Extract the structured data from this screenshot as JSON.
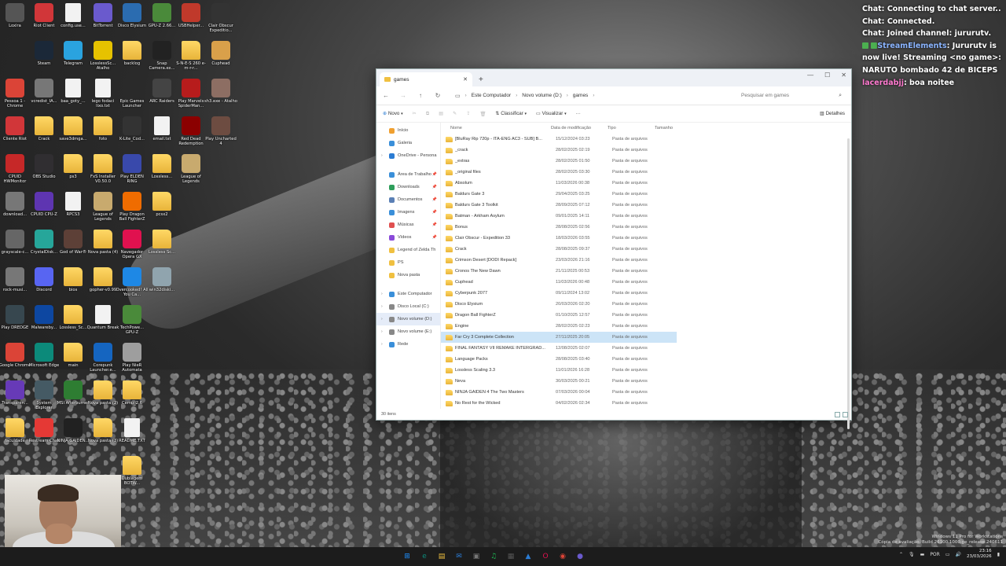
{
  "desktop_icons": [
    {
      "label": "Loxira",
      "kind": "app",
      "color": "#555555"
    },
    {
      "label": "Riot Client",
      "kind": "app",
      "color": "#d13639"
    },
    {
      "label": "config.use...",
      "kind": "file",
      "color": "#f2f2f2"
    },
    {
      "label": "BitTorrent",
      "kind": "app",
      "color": "#6a5acd"
    },
    {
      "label": "Disco Elysium",
      "kind": "app",
      "color": "#2b6cb0"
    },
    {
      "label": "GPU-Z 2.66...",
      "kind": "app",
      "color": "#4a8a3a"
    },
    {
      "label": "USBHelper...",
      "kind": "app",
      "color": "#c0392b"
    },
    {
      "label": "Clair Obscur Expeditio...",
      "kind": "app",
      "color": "#333333"
    },
    {
      "label": "Steam",
      "kind": "app",
      "color": "#1b2838"
    },
    {
      "label": "Telegram",
      "kind": "app",
      "color": "#2aa3df"
    },
    {
      "label": "LosslessSc... Atalho",
      "kind": "app",
      "color": "#e6c200"
    },
    {
      "label": "backlog",
      "kind": "folder",
      "color": "#f0c040"
    },
    {
      "label": "Snap Camera.ex...",
      "kind": "app",
      "color": "#222222"
    },
    {
      "label": "S-N-E-S 260 e-m-r-r...",
      "kind": "folder",
      "color": "#f0c040"
    },
    {
      "label": "Cuphead",
      "kind": "app",
      "color": "#d9a04a"
    },
    {
      "label": "Pessoa 1 - Chrome",
      "kind": "app",
      "color": "#db4437"
    },
    {
      "label": "vcredist_IA...",
      "kind": "app",
      "color": "#777777"
    },
    {
      "label": "baa_goty_...",
      "kind": "file",
      "color": "#f2f2f2"
    },
    {
      "label": "lego fodaci lixo.txt",
      "kind": "file",
      "color": "#f2f2f2"
    },
    {
      "label": "Epic Games Launcher",
      "kind": "app",
      "color": "#2a2a2a"
    },
    {
      "label": "ARC Raiders",
      "kind": "app",
      "color": "#444444"
    },
    {
      "label": "Play Marvels SpiderMan...",
      "kind": "app",
      "color": "#b71c1c"
    },
    {
      "label": "sh3.exe - Atalho",
      "kind": "app",
      "color": "#8d6e63"
    },
    {
      "label": "Cliente Riot",
      "kind": "app",
      "color": "#d13639"
    },
    {
      "label": "Crack",
      "kind": "folder",
      "color": "#f0c040"
    },
    {
      "label": "save3dmga...",
      "kind": "folder",
      "color": "#f0c040"
    },
    {
      "label": "foto",
      "kind": "folder",
      "color": "#f0c040"
    },
    {
      "label": "K-Lite_Cod...",
      "kind": "app",
      "color": "#333333"
    },
    {
      "label": "email.txt",
      "kind": "file",
      "color": "#f2f2f2"
    },
    {
      "label": "Red Dead Redemption",
      "kind": "app",
      "color": "#8b0000"
    },
    {
      "label": "Play Uncharted 4",
      "kind": "app",
      "color": "#6d4c41"
    },
    {
      "label": "CPUID HWMonitor",
      "kind": "app",
      "color": "#c62828"
    },
    {
      "label": "OBS Studio",
      "kind": "app",
      "color": "#302e31"
    },
    {
      "label": "ps3",
      "kind": "folder",
      "color": "#f0c040"
    },
    {
      "label": "FxS Installer V0.50.0",
      "kind": "folder",
      "color": "#f0c040"
    },
    {
      "label": "Play ELDEN RING",
      "kind": "app",
      "color": "#3949ab"
    },
    {
      "label": "Lossless...",
      "kind": "folder",
      "color": "#f0c040"
    },
    {
      "label": "League of Legends",
      "kind": "app",
      "color": "#c8aa6e"
    },
    {
      "label": "download...",
      "kind": "app",
      "color": "#777777"
    },
    {
      "label": "CPUID CPU-Z",
      "kind": "app",
      "color": "#5e35b1"
    },
    {
      "label": "RPCS3",
      "kind": "file",
      "color": "#f2f2f2"
    },
    {
      "label": "League of Legends",
      "kind": "app",
      "color": "#c8aa6e"
    },
    {
      "label": "Play Dragon Ball FighterZ",
      "kind": "app",
      "color": "#ef6c00"
    },
    {
      "label": "pcsx2",
      "kind": "folder",
      "color": "#f0c040"
    },
    {
      "label": "grayscale-c...",
      "kind": "app",
      "color": "#666666"
    },
    {
      "label": "CrystalDisk...",
      "kind": "app",
      "color": "#26a69a"
    },
    {
      "label": "God of War®",
      "kind": "app",
      "color": "#5d4037"
    },
    {
      "label": "Nova pasta (4)",
      "kind": "folder",
      "color": "#f0c040"
    },
    {
      "label": "Navegador Opera GX",
      "kind": "app",
      "color": "#e0114f"
    },
    {
      "label": "Lossless Sc...",
      "kind": "folder",
      "color": "#f0c040"
    },
    {
      "label": "rock-musi...",
      "kind": "app",
      "color": "#777777"
    },
    {
      "label": "Discord",
      "kind": "app",
      "color": "#5865f2"
    },
    {
      "label": "bios",
      "kind": "folder",
      "color": "#f0c040"
    },
    {
      "label": "gopher-v0.99",
      "kind": "folder",
      "color": "#f0c040"
    },
    {
      "label": "Overcooked! All You Ca...",
      "kind": "app",
      "color": "#1e88e5"
    },
    {
      "label": "win32diski...",
      "kind": "app",
      "color": "#90a4ae"
    },
    {
      "label": "Play DREDGE",
      "kind": "app",
      "color": "#37474f"
    },
    {
      "label": "Malwareby...",
      "kind": "app",
      "color": "#0d47a1"
    },
    {
      "label": "Lossless_Sc...",
      "kind": "folder",
      "color": "#f0c040"
    },
    {
      "label": "Quantum Break",
      "kind": "file",
      "color": "#f2f2f2"
    },
    {
      "label": "TechPowe... GPU-Z",
      "kind": "app",
      "color": "#4a8a3a"
    },
    {
      "label": "Google Chrome",
      "kind": "app",
      "color": "#db4437"
    },
    {
      "label": "Microsoft Edge",
      "kind": "app",
      "color": "#0c8a7a"
    },
    {
      "label": "main",
      "kind": "folder",
      "color": "#f0c040"
    },
    {
      "label": "Corepunk Launcher.e...",
      "kind": "app",
      "color": "#1565c0"
    },
    {
      "label": "Play NieR Automata",
      "kind": "app",
      "color": "#9e9e9e"
    },
    {
      "label": "Transparen...",
      "kind": "app",
      "color": "#673ab7"
    },
    {
      "label": "System Explorer",
      "kind": "app",
      "color": "#455a64"
    },
    {
      "label": "MSI Afterburner",
      "kind": "app",
      "color": "#2e7d32"
    },
    {
      "label": "Nova pasta (2)",
      "kind": "folder",
      "color": "#f0c040"
    },
    {
      "label": "Cemu_2.6",
      "kind": "folder",
      "color": "#f0c040"
    },
    {
      "label": "faculdade",
      "kind": "folder",
      "color": "#f0c040"
    },
    {
      "label": "Restream Chat",
      "kind": "app",
      "color": "#e53935"
    },
    {
      "label": "NINJA GAIDEN...",
      "kind": "app",
      "color": "#212121"
    },
    {
      "label": "Nova pasta (3)",
      "kind": "folder",
      "color": "#f0c040"
    },
    {
      "label": "README.TXT",
      "kind": "file",
      "color": "#f2f2f2"
    },
    {
      "label": "Dublagem BOTW...",
      "kind": "folder",
      "color": "#f0c040"
    }
  ],
  "chat": {
    "line1_name": "Chat:",
    "line1_text": "Connecting to chat server..",
    "line2_name": "Chat:",
    "line2_text": "Connected.",
    "line3_name": "Chat:",
    "line3_text": "Joined channel: jururutv.",
    "line4_name": "StreamElements",
    "line4_text": ": Jururutv is now live! Streaming <no game>: NARUTO bombado 42 de BICEPS",
    "line5_name": "lacerdabjj",
    "line5_text": ": boa noitee"
  },
  "explorer": {
    "tab_title": "games",
    "new_tab": "+",
    "address": {
      "root": "Este Computador",
      "drive": "Novo volume (D:)",
      "folder": "games"
    },
    "search_placeholder": "Pesquisar em games",
    "cmd": {
      "new": "Novo",
      "sort": "Classificar",
      "view": "Visualizar",
      "more": "···",
      "details": "Detalhes"
    },
    "nav": [
      {
        "label": "Início",
        "color": "#f0a030"
      },
      {
        "label": "Galeria",
        "color": "#3a8fd9"
      },
      {
        "label": "OneDrive - Persona",
        "color": "#2b7cd3",
        "chev": true
      },
      {
        "label": "Área de Trabalho",
        "color": "#3a8fd9",
        "pin": true
      },
      {
        "label": "Downloads",
        "color": "#2e9e5b",
        "pin": true
      },
      {
        "label": "Documentos",
        "color": "#5a7fb5",
        "pin": true
      },
      {
        "label": "Imagens",
        "color": "#3a8fd9",
        "pin": true
      },
      {
        "label": "Músicas",
        "color": "#e05050",
        "pin": true
      },
      {
        "label": "Vídeos",
        "color": "#8a4ad9",
        "pin": true
      },
      {
        "label": "Legend of Zelda Th",
        "color": "#f0c040"
      },
      {
        "label": "PS",
        "color": "#f0c040"
      },
      {
        "label": "Nova pasta",
        "color": "#f0c040"
      },
      {
        "label": "Este Computador",
        "color": "#3a8fd9",
        "chev": true
      },
      {
        "label": "Disco Local (C:)",
        "color": "#888888",
        "chev": true
      },
      {
        "label": "Novo volume (D:)",
        "color": "#888888",
        "chev": true,
        "selected": true
      },
      {
        "label": "Novo volume (E:)",
        "color": "#888888",
        "chev": true
      },
      {
        "label": "Rede",
        "color": "#3a8fd9",
        "chev": true
      }
    ],
    "columns": {
      "name": "Nome",
      "date": "Data de modificação",
      "type": "Tipo",
      "size": "Tamanho"
    },
    "files": [
      {
        "name": "[BluRay Rip 720p - ITA-ENG AC3 - SUB] B...",
        "date": "15/12/2024 03:23",
        "type": "Pasta de arquivos"
      },
      {
        "name": "_crack",
        "date": "28/02/2025 02:19",
        "type": "Pasta de arquivos"
      },
      {
        "name": "_extras",
        "date": "28/02/2025 01:50",
        "type": "Pasta de arquivos"
      },
      {
        "name": "_original files",
        "date": "28/02/2025 03:30",
        "type": "Pasta de arquivos"
      },
      {
        "name": "Absolum",
        "date": "11/03/2026 00:38",
        "type": "Pasta de arquivos"
      },
      {
        "name": "Baldurs Gate 3",
        "date": "29/04/2025 03:25",
        "type": "Pasta de arquivos"
      },
      {
        "name": "Baldurs Gate 3 Toolkit",
        "date": "28/09/2025 07:12",
        "type": "Pasta de arquivos"
      },
      {
        "name": "Batman - Arkham Asylum",
        "date": "09/01/2025 14:11",
        "type": "Pasta de arquivos"
      },
      {
        "name": "Bonus",
        "date": "28/08/2025 02:56",
        "type": "Pasta de arquivos"
      },
      {
        "name": "Clair Obscur - Expedition 33",
        "date": "18/03/2026 03:55",
        "type": "Pasta de arquivos"
      },
      {
        "name": "Crack",
        "date": "28/08/2025 09:37",
        "type": "Pasta de arquivos"
      },
      {
        "name": "Crimson Desert [DODI Repack]",
        "date": "23/03/2026 21:16",
        "type": "Pasta de arquivos"
      },
      {
        "name": "Cronos The New Dawn",
        "date": "21/11/2025 00:53",
        "type": "Pasta de arquivos"
      },
      {
        "name": "Cuphead",
        "date": "11/03/2026 00:48",
        "type": "Pasta de arquivos"
      },
      {
        "name": "Cyberpunk 2077",
        "date": "09/11/2024 13:02",
        "type": "Pasta de arquivos"
      },
      {
        "name": "Disco Elysium",
        "date": "20/03/2026 02:20",
        "type": "Pasta de arquivos"
      },
      {
        "name": "Dragon Ball FighterZ",
        "date": "01/10/2025 12:57",
        "type": "Pasta de arquivos"
      },
      {
        "name": "Engine",
        "date": "28/02/2025 02:23",
        "type": "Pasta de arquivos"
      },
      {
        "name": "Far Cry 3 Complete Collection",
        "date": "27/11/2025 20:05",
        "type": "Pasta de arquivos",
        "selected": true
      },
      {
        "name": "FINAL FANTASY VII REMAKE INTERGRAD...",
        "date": "12/08/2025 02:07",
        "type": "Pasta de arquivos"
      },
      {
        "name": "Language Packs",
        "date": "28/08/2025 03:40",
        "type": "Pasta de arquivos"
      },
      {
        "name": "Lossless Scaling 3.3",
        "date": "11/01/2026 16:28",
        "type": "Pasta de arquivos"
      },
      {
        "name": "Neva",
        "date": "30/03/2025 00:21",
        "type": "Pasta de arquivos"
      },
      {
        "name": "NINJA GAIDEN 4 The Two Masters",
        "date": "07/03/2026 00:04",
        "type": "Pasta de arquivos"
      },
      {
        "name": "No Rest for the Wicked",
        "date": "04/02/2026 02:34",
        "type": "Pasta de arquivos"
      }
    ],
    "status": "30 itens"
  },
  "taskbar": {
    "apps": [
      {
        "icon": "windows-start-icon",
        "glyph": "⊞",
        "color": "#1e90ff"
      },
      {
        "icon": "edge-icon",
        "glyph": "e",
        "color": "#0c8a7a"
      },
      {
        "icon": "file-explorer-icon",
        "glyph": "▤",
        "color": "#f0c040"
      },
      {
        "icon": "mail-icon",
        "glyph": "✉",
        "color": "#2b7cd3"
      },
      {
        "icon": "store-icon",
        "glyph": "▣",
        "color": "#777777"
      },
      {
        "icon": "spotify-icon",
        "glyph": "♫",
        "color": "#1db954"
      },
      {
        "icon": "app-icon",
        "glyph": "▦",
        "color": "#555555"
      },
      {
        "icon": "photos-icon",
        "glyph": "▲",
        "color": "#2b7cd3"
      },
      {
        "icon": "opera-gx-icon",
        "glyph": "O",
        "color": "#e0114f"
      },
      {
        "icon": "chrome-icon",
        "glyph": "◉",
        "color": "#db4437"
      },
      {
        "icon": "obs-icon",
        "glyph": "●",
        "color": "#6a5acd"
      }
    ],
    "lang": "POR",
    "time": "23:16",
    "date": "23/03/2026"
  },
  "watermark": {
    "line1": "Windows 11 Pro for Workstations",
    "line2": "Cópia de avaliação. Build 26100.1000.ge_release.240611"
  }
}
